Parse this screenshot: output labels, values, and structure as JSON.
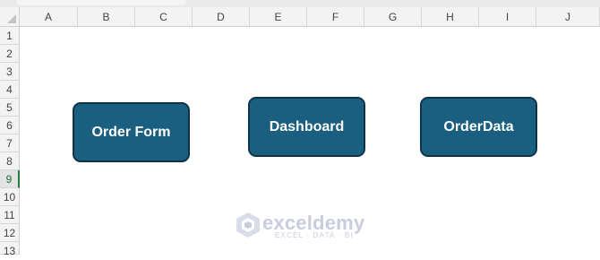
{
  "columns": [
    "A",
    "B",
    "C",
    "D",
    "E",
    "F",
    "G",
    "H",
    "I",
    "J"
  ],
  "rows": [
    "1",
    "2",
    "3",
    "4",
    "5",
    "6",
    "7",
    "8",
    "9",
    "10",
    "11",
    "12",
    "13"
  ],
  "active_row": "9",
  "buttons": {
    "order_form": "Order Form",
    "dashboard": "Dashboard",
    "order_data": "OrderData"
  },
  "watermark": {
    "name": "exceldemy",
    "tagline": "EXCEL · DATA · BI",
    "icon": "exceldemy-logo-icon"
  },
  "colors": {
    "button_fill": "#1b5f80",
    "button_border": "#0d3446",
    "active_row_accent": "#1e7c45"
  }
}
